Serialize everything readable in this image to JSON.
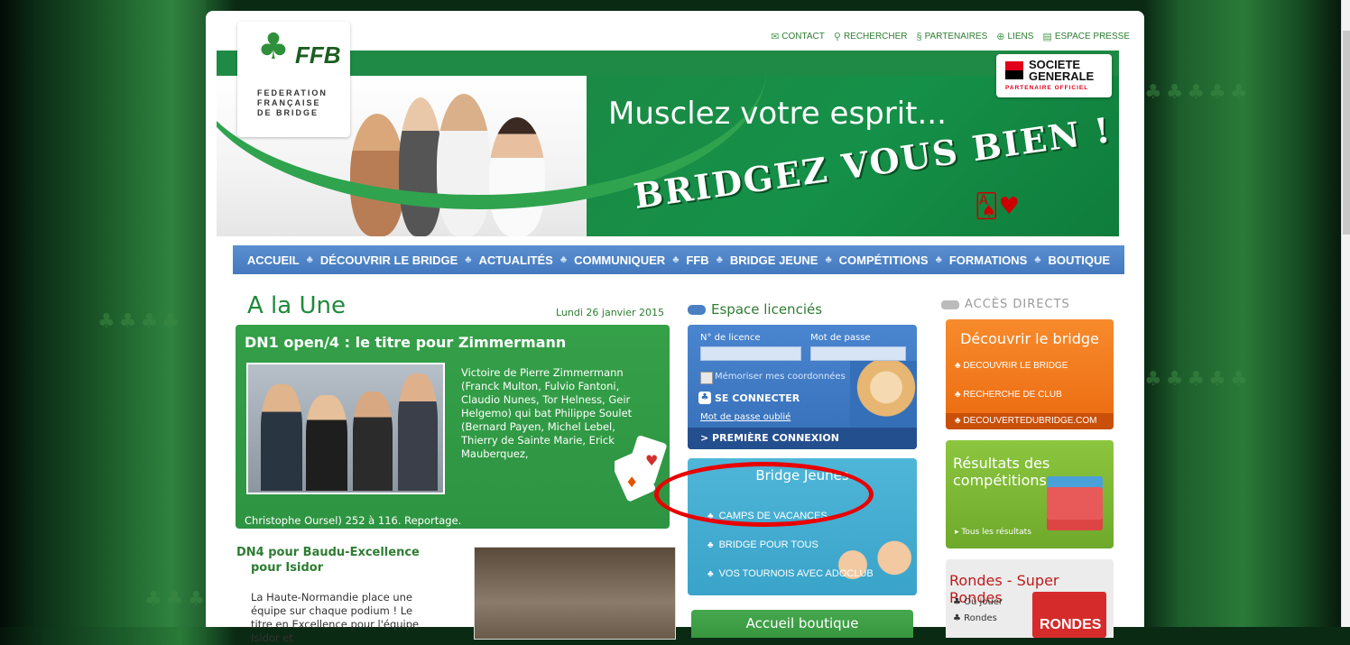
{
  "toplinks": [
    {
      "icon": "mail-icon",
      "label": "CONTACT"
    },
    {
      "icon": "search-icon",
      "label": "RECHERCHER"
    },
    {
      "icon": "partners-icon",
      "label": "PARTENAIRES"
    },
    {
      "icon": "links-icon",
      "label": "LIENS"
    },
    {
      "icon": "press-icon",
      "label": "ESPACE PRESSE"
    }
  ],
  "logo": {
    "short": "FFB",
    "line1": "FEDERATION",
    "line2": "FRANÇAISE",
    "line3": "DE BRIDGE"
  },
  "banner": {
    "slogan1": "Musclez votre esprit...",
    "slogan2": "BRIDGEZ VOUS BIEN !",
    "sponsor_line1": "SOCIETE",
    "sponsor_line2": "GENERALE",
    "sponsor_sub": "PARTENAIRE OFFICIEL"
  },
  "nav": [
    "ACCUEIL",
    "DÉCOUVRIR LE BRIDGE",
    "ACTUALITÉS",
    "COMMUNIQUER",
    "FFB",
    "BRIDGE JEUNE",
    "COMPÉTITIONS",
    "FORMATIONS",
    "BOUTIQUE"
  ],
  "main": {
    "title": "A la Une",
    "date": "Lundi 26 janvier 2015",
    "feature_title": "DN1 open/4 : le titre pour Zimmermann",
    "feature_text": "Victoire de Pierre Zimmermann (Franck Multon, Fulvio Fantoni, Claudio Nunes, Tor Helness, Geir Helgemo) qui bat Philippe Soulet (Bernard Payen, Michel Lebel, Thierry de Sainte Marie, Erick Mauberquez,",
    "feature_cont": "Christophe Oursel) 252 à 116. Reportage.",
    "news2_title_1": "DN4 pour Baudu-Excellence",
    "news2_title_2": "pour Isidor",
    "news2_text": "La Haute-Normandie place une équipe sur chaque podium ! Le titre en Excellence pour l'équipe Isidor et"
  },
  "espace": {
    "title": "Espace licenciés",
    "licence_label": "N° de licence",
    "password_label": "Mot de passe",
    "remember": "Mémoriser mes coordonnées",
    "connect": "SE CONNECTER",
    "forgot": "Mot de passe oublié",
    "first": "> PREMIÈRE CONNEXION"
  },
  "jeunes": {
    "title": "Bridge Jeunes",
    "items": [
      "CAMPS DE VACANCES",
      "BRIDGE POUR TOUS",
      "VOS TOURNOIS AVEC ADOCLUB"
    ]
  },
  "boutique": {
    "title": "Accueil boutique"
  },
  "acces": {
    "title": "ACCÈS DIRECTS",
    "decouvrir_title": "Découvrir le bridge",
    "decouvrir_items": [
      "DECOUVRIR LE BRIDGE",
      "RECHERCHE DE CLUB",
      "DECOUVERTEDUBRIDGE.COM"
    ],
    "resultats_title_1": "Résultats des",
    "resultats_title_2": "compétitions",
    "resultats_more": "Tous les résultats",
    "rondes_title": "Rondes - Super Rondes",
    "rondes_items": [
      "Où jouer",
      "Rondes"
    ],
    "rondes_logo": "RONDES"
  },
  "colors": {
    "green": "#2e7d32",
    "nav_blue": "#4479bf",
    "orange": "#ec6a10",
    "lime": "#6ea92b",
    "teal": "#3aa3c9",
    "highlight": "#e80000"
  }
}
